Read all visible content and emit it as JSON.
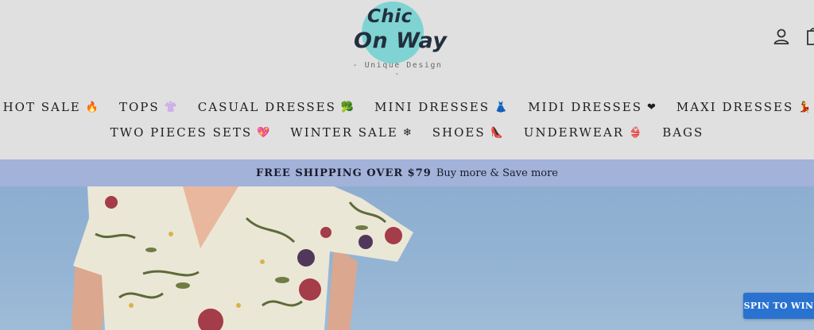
{
  "header": {
    "logo": {
      "line1": "Chic",
      "line2": "On Way",
      "tagline": "- Unique Design -"
    },
    "icons": {
      "account": "user-icon",
      "cart": "cart-icon"
    }
  },
  "nav": {
    "row1": [
      {
        "label": "HOT SALE",
        "emoji": "🔥"
      },
      {
        "label": "TOPS",
        "emoji": "👚"
      },
      {
        "label": "CASUAL DRESSES",
        "emoji": "🥦"
      },
      {
        "label": "MINI DRESSES",
        "emoji": "👗"
      },
      {
        "label": "MIDI DRESSES",
        "emoji": "❤"
      },
      {
        "label": "MAXI DRESSES",
        "emoji": "💃"
      }
    ],
    "row2": [
      {
        "label": "TWO PIECES SETS",
        "emoji": "💖"
      },
      {
        "label": "WINTER SALE",
        "emoji": "❄"
      },
      {
        "label": "SHOES",
        "emoji": "👠"
      },
      {
        "label": "UNDERWEAR",
        "emoji": "👙"
      },
      {
        "label": "BAGS",
        "emoji": ""
      }
    ]
  },
  "promo": {
    "bold": "FREE SHIPPING OVER $79",
    "text": "Buy more & Save more"
  },
  "spin": {
    "label": "SPIN TO WIN"
  },
  "colors": {
    "header_bg": "#e0e0e0",
    "promo_bg": "#a2b2d9",
    "logo_circle": "#7fd3d3",
    "spin_bg": "#2a72d0"
  }
}
